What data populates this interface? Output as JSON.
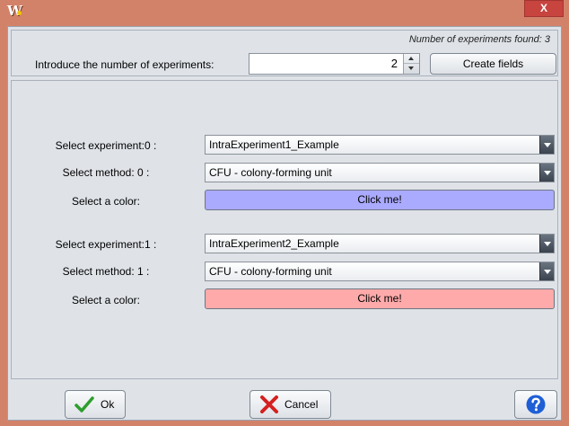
{
  "window": {
    "app_icon_glyph": "W",
    "close_glyph": "X"
  },
  "header": {
    "found_label": "Number of experiments found: 3",
    "intro_label": "Introduce the number of experiments:",
    "spinner_value": "2",
    "create_button": "Create fields"
  },
  "experiments": [
    {
      "experiment_label": "Select experiment:0 :",
      "experiment_value": "IntraExperiment1_Example",
      "method_label": "Select method: 0 :",
      "method_value": "CFU - colony-forming unit",
      "color_label": "Select a color:",
      "color_button": "Click me!",
      "color": "#aaaaff"
    },
    {
      "experiment_label": "Select experiment:1 :",
      "experiment_value": "IntraExperiment2_Example",
      "method_label": "Select method: 1 :",
      "method_value": "CFU - colony-forming unit",
      "color_label": "Select a color:",
      "color_button": "Click me!",
      "color": "#ffaaaa"
    }
  ],
  "footer": {
    "ok_button": "Ok",
    "cancel_button": "Cancel",
    "ok_icon": "checkmark-icon",
    "cancel_icon": "red-x-icon",
    "help_icon": "help-question-icon"
  },
  "colors": {
    "title_bar": "#d3826a",
    "close_button": "#c7443f",
    "panel_background": "#dfe3e8",
    "help_blue": "#1f5fd6"
  }
}
